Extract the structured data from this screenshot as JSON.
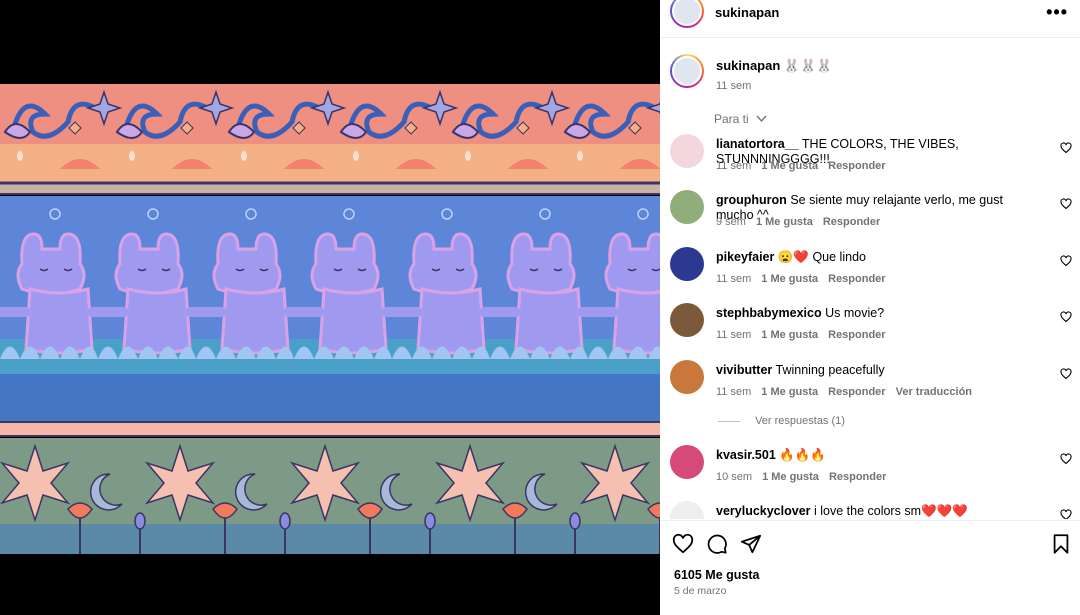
{
  "post": {
    "username": "sukinapan",
    "more_label": "•••",
    "caption": {
      "username": "sukinapan",
      "text": "🐰🐰🐰",
      "time": "11 sem"
    },
    "sort_label": "Para ti"
  },
  "comments": [
    {
      "user": "lianatortora__",
      "text": "THE COLORS, THE VIBES, STUNNNINGGGG!!!",
      "time": "11 sem",
      "likes": "1 Me gusta",
      "reply": "Responder",
      "translate": "",
      "avatar_color": "#f3d7dc"
    },
    {
      "user": "grouphuron",
      "text": "Se siente muy relajante verlo, me gust mucho ^^",
      "time": "9 sem",
      "likes": "1 Me gusta",
      "reply": "Responder",
      "translate": "",
      "avatar_color": "#8fae7a"
    },
    {
      "user": "pikeyfaier",
      "text": "😦❤️ Que lindo",
      "time": "11 sem",
      "likes": "1 Me gusta",
      "reply": "Responder",
      "translate": "",
      "avatar_color": "#2b3a8f"
    },
    {
      "user": "stephbabymexico",
      "text": "Us movie?",
      "time": "11 sem",
      "likes": "1 Me gusta",
      "reply": "Responder",
      "translate": "",
      "avatar_color": "#7a5a3a"
    },
    {
      "user": "vivibutter",
      "text": "Twinning peacefully",
      "time": "11 sem",
      "likes": "1 Me gusta",
      "reply": "Responder",
      "translate": "Ver traducción",
      "avatar_color": "#c8783a"
    },
    {
      "user": "kvasir.501",
      "text": "🔥🔥🔥",
      "time": "10 sem",
      "likes": "1 Me gusta",
      "reply": "Responder",
      "translate": "",
      "avatar_color": "#d64a7a"
    },
    {
      "user": "veryluckyclover",
      "text": "i love the colors sm❤️❤️❤️",
      "time": "",
      "likes": "",
      "reply": "",
      "translate": "",
      "avatar_color": "#eeeeee"
    }
  ],
  "view_replies": "Ver respuestas (1)",
  "footer": {
    "likes": "6105 Me gusta",
    "date": "5 de marzo"
  },
  "icons": {
    "more": "more-options-icon",
    "like": "heart-icon",
    "comment": "comment-icon",
    "share": "paper-plane-icon",
    "save": "bookmark-icon",
    "chevron": "chevron-down-icon"
  }
}
